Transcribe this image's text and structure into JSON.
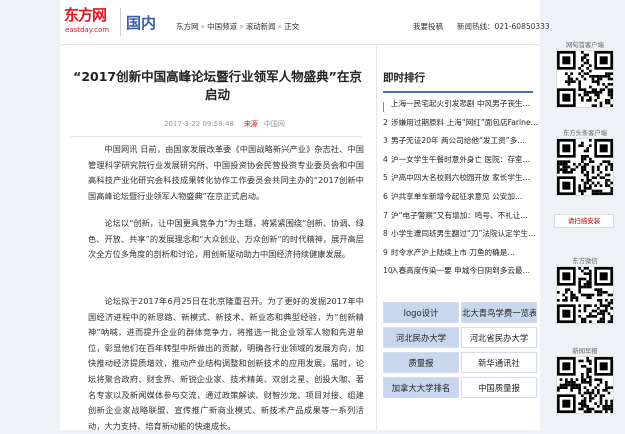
{
  "header": {
    "logo_brand": "东方网",
    "logo_domain": "eastday.com",
    "channel": "国内",
    "breadcrumb": [
      "东方网",
      "中国频道",
      "滚动新闻",
      "正文"
    ],
    "breadcrumb_sep": "»",
    "submit_label": "我要投稿",
    "hotline": "新闻热线：021-60850333"
  },
  "article": {
    "title_line1": "“2017创新中国高峰论坛暨行业领军人物盛典”在京启动",
    "date": "2017-3-22 09:59:48",
    "source_label": "来源",
    "source_name": "中国网",
    "paragraphs": [
      "中国网讯 日前，由国家发展改革委《中国战略新兴产业》杂志社、中国管理科学研究院行业发展研究所、中国投资协会民营投资专业委员会和中国高科技产业化研究会科技成果转化协作工作委员会共同主办的“2017创新中国高峰论坛暨行业领军人物盛典”在京正式启动。",
      "论坛以“创新，让中国更具竞争力”为主题，将紧紧围绕“创新、协调、绿色、开放、共享”的发展理念和“大众创业、万众创新”的时代精神，展开高层次全方位多角度的剖析和讨论，用创新驱动助力中国经济持续健康发展。",
      "论坛拟于2017年6月25日在北京隆重召开。为了更好的发掘2017年中国经济进程中的新思路、新模式、新技术、新业态和典型经验，为“创新精神”呐喊，进而提升企业的群体竞争力，将推选一批企业领军人物和先进单位，彰显他们在百年转型中所做出的贡献，明确各行业领域的发展方向，加快推动经济提质增效，推动产业结构调整和创新技术的应用发展。届时，论坛将聚合政府、财金界、新锐企业家、技术精英、双创之星、创投大咖、著名专家以及新闻媒体参与交流，通过政策解读、财智沙龙、项目对接、组建创新企业家战略联盟、宣传推广新商业模式、新技术产品成果等一系列活动，大力支持、培育新动能的快速成长。"
    ]
  },
  "ranking": {
    "title": "即时排行",
    "items": [
      {
        "num": "1",
        "text": "上海一民宅起火引发悲剧 中风男子丧生…"
      },
      {
        "num": "2",
        "text": "涉嫌用过期原料 上海“网红”面包店Farine…"
      },
      {
        "num": "3",
        "text": "男子无证20年 两公司给他“发工资”多…"
      },
      {
        "num": "4",
        "text": "沪一女学生午餐时意外身亡 医院：存室…"
      },
      {
        "num": "5",
        "text": "沪高中四大名校则六校园开放 家长学生…"
      },
      {
        "num": "6",
        "text": "沪共享单车新增今起征求意见 公安加…"
      },
      {
        "num": "7",
        "text": "沪“电子警察”又有增加：鸣号、不礼让…"
      },
      {
        "num": "8",
        "text": "小学生遭同班男生翻过“刀”法院认定学生…"
      },
      {
        "num": "9",
        "text": "时令水产沪上陆续上市 刀鱼的确是…"
      },
      {
        "num": "10",
        "text": "入春高度传染一要 申城今日阴到多云最…"
      }
    ]
  },
  "links": [
    {
      "label": "logo设计",
      "style": "blue"
    },
    {
      "label": "北大青鸟学费一览表",
      "style": "blue"
    },
    {
      "label": "河北民办大学",
      "style": "blue"
    },
    {
      "label": "河北省民办大学",
      "style": "white"
    },
    {
      "label": "质量报",
      "style": "blue"
    },
    {
      "label": "新华通讯社",
      "style": "white"
    },
    {
      "label": "加拿大大学排名",
      "style": "blue"
    },
    {
      "label": "中国质量报",
      "style": "white"
    }
  ],
  "sidebar": {
    "qr1_label": "网旬首客户端",
    "qr2_label": "东方头条客户端",
    "download_label": "请扫描安装",
    "qr3_label": "东方微信",
    "qr4_label": "新闻早报"
  }
}
